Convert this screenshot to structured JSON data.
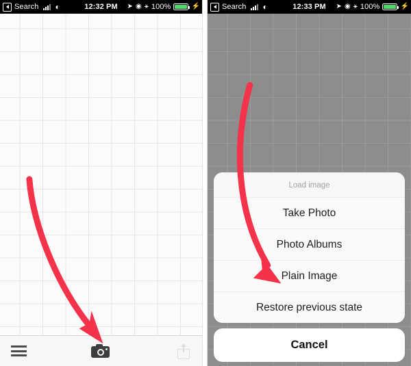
{
  "panels": [
    {
      "id": "left",
      "status_bar": {
        "back_label": "Search",
        "time": "12:32 PM",
        "battery_percent": "100%",
        "icons": {
          "back": "back-chevron-icon",
          "signal": "cellular-signal-icon",
          "wifi": "wifi-icon",
          "location": "location-arrow-icon",
          "alarm": "alarm-clock-icon",
          "bluetooth": "bluetooth-icon",
          "battery": "battery-icon",
          "charging": "lightning-bolt-icon"
        }
      },
      "toolbar": {
        "menu_icon": "hamburger-menu-icon",
        "camera_icon": "camera-icon",
        "share_icon": "share-export-icon"
      },
      "annotation": {
        "type": "curved-arrow",
        "color": "#f4334a",
        "points_to": "camera-icon"
      }
    },
    {
      "id": "right",
      "status_bar": {
        "back_label": "Search",
        "time": "12:33 PM",
        "battery_percent": "100%",
        "icons": {
          "back": "back-chevron-icon",
          "signal": "cellular-signal-icon",
          "wifi": "wifi-icon",
          "location": "location-arrow-icon",
          "alarm": "alarm-clock-icon",
          "bluetooth": "bluetooth-icon",
          "battery": "battery-icon",
          "charging": "lightning-bolt-icon"
        }
      },
      "action_sheet": {
        "title": "Load image",
        "options": [
          "Take Photo",
          "Photo Albums",
          "Plain Image",
          "Restore previous state"
        ],
        "cancel_label": "Cancel"
      },
      "annotation": {
        "type": "curved-arrow",
        "color": "#f4334a",
        "points_to": "Plain Image"
      }
    }
  ],
  "colors": {
    "accent_red": "#f4334a",
    "status_bar_bg": "#000000",
    "battery_green": "#4cd964",
    "dim_overlay": "#8d8d8d",
    "sheet_bg": "#fafafa",
    "grid_line": "#e6e6e6"
  }
}
